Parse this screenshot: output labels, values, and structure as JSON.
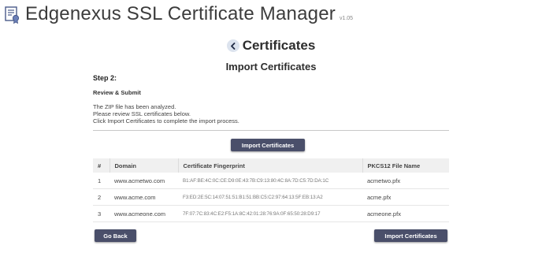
{
  "app": {
    "title": "Edgenexus SSL Certificate Manager",
    "version": "v1.05"
  },
  "page": {
    "title": "Certificates",
    "subtitle": "Import Certificates"
  },
  "step": {
    "label": "Step 2:",
    "section": "Review & Submit",
    "info_lines": [
      "The ZIP file has been analyzed.",
      "Please review SSL certificates below.",
      "Click Import Certificates to complete the import process."
    ]
  },
  "buttons": {
    "import_top": "Import Certificates",
    "go_back": "Go Back",
    "import_bottom": "Import Certificates"
  },
  "table": {
    "headers": [
      "#",
      "Domain",
      "Certificate Fingerprint",
      "PKCS12 File Name"
    ],
    "rows": [
      {
        "num": "1",
        "domain": "www.acmetwo.com",
        "fingerprint": "B1:AF:BE:4C:0C:CE:D9:0E:43:7B:C9:13:80:4C:8A:7D:C5:7D:DA:1C",
        "file": "acmetwo.pfx"
      },
      {
        "num": "2",
        "domain": "www.acme.com",
        "fingerprint": "F3:ED:2E:5C:14:07:51:51:B1:51:BB:C5:C2:97:64:13:5F:EB:13:A2",
        "file": "acme.pfx"
      },
      {
        "num": "3",
        "domain": "www.acmeone.com",
        "fingerprint": "7F:07:7C:83:4C:E2:F5:1A:8C:42:01:28:76:9A:0F:65:50:28:D9:17",
        "file": "acmeone.pfx"
      }
    ]
  },
  "colors": {
    "button_bg": "#4a4f6a",
    "back_circle": "#dce3ee",
    "header_row": "#f0f0f0"
  },
  "icons": {
    "logo": "certificate-icon",
    "back": "chevron-left-icon"
  }
}
